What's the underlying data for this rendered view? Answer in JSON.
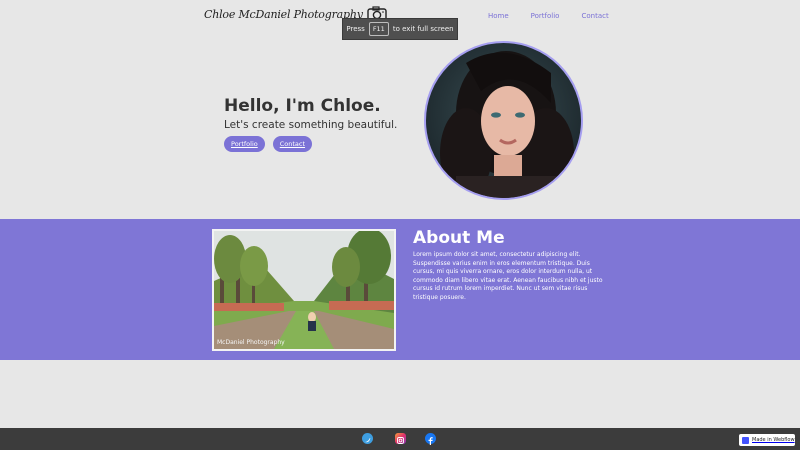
{
  "header": {
    "logo_text": "Chloe McDaniel Photography",
    "logo_icon": "camera-icon",
    "nav": [
      "Home",
      "Portfolio",
      "Contact"
    ]
  },
  "fullscreen_toast": {
    "prefix": "Press",
    "key": "F11",
    "suffix": "to exit full screen"
  },
  "hero": {
    "title": "Hello, I'm Chloe.",
    "subtitle": "Let's create something beautiful.",
    "buttons": [
      "Portfolio",
      "Contact"
    ],
    "portrait_icon": "portrait-photo"
  },
  "about": {
    "title": "About Me",
    "body": "Lorem ipsum dolor sit amet, consectetur adipiscing elit. Suspendisse varius enim in eros elementum tristique. Duis cursus, mi quis viverra ornare, eros dolor interdum nulla, ut commodo diam libero vitae erat. Aenean faucibus nibh et justo cursus id rutrum lorem imperdiet. Nunc ut sem vitae risus tristique posuere.",
    "photo_watermark": "McDaniel Photography"
  },
  "footer": {
    "social": [
      "twitter-icon",
      "instagram-icon",
      "facebook-icon"
    ],
    "badge": "Made in Webflow"
  },
  "colors": {
    "accent": "#7b72d6",
    "about_bg": "#7f76d6",
    "page_bg": "#e7e7e7",
    "footer_bg": "#3c3c3c"
  }
}
